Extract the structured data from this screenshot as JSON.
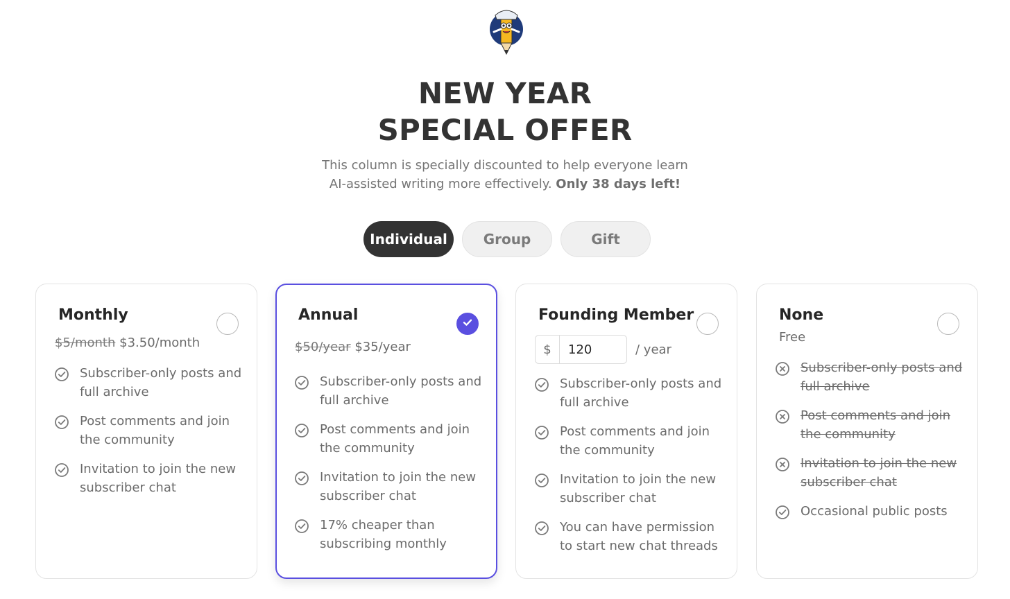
{
  "header": {
    "title": "NEW YEAR SPECIAL OFFER",
    "subtitle_text": "This column is specially discounted to help everyone learn AI-assisted writing more effectively.",
    "subtitle_bold": "Only 38 days left!"
  },
  "tabs": [
    {
      "label": "Individual",
      "active": true
    },
    {
      "label": "Group",
      "active": false
    },
    {
      "label": "Gift",
      "active": false
    }
  ],
  "accent_color": "#5a4fe0",
  "plans": {
    "monthly": {
      "name": "Monthly",
      "old_price": "$5/month",
      "new_price": "$3.50/month",
      "selected": false,
      "features": [
        "Subscriber-only posts and full archive",
        "Post comments and join the community",
        "Invitation to join the new subscriber chat"
      ]
    },
    "annual": {
      "name": "Annual",
      "old_price": "$50/year",
      "new_price": "$35/year",
      "selected": true,
      "features": [
        "Subscriber-only posts and full archive",
        "Post comments and join the community",
        "Invitation to join the new subscriber chat",
        "17% cheaper than subscribing monthly"
      ]
    },
    "founding": {
      "name": "Founding Member",
      "currency": "$",
      "amount": "120",
      "period": "/ year",
      "selected": false,
      "features": [
        "Subscriber-only posts and full archive",
        "Post comments and join the community",
        "Invitation to join the new subscriber chat",
        "You can have permission to start new chat threads"
      ]
    },
    "none": {
      "name": "None",
      "price": "Free",
      "selected": false,
      "features": [
        {
          "text": "Subscriber-only posts and full archive",
          "included": false
        },
        {
          "text": "Post comments and join the community",
          "included": false
        },
        {
          "text": "Invitation to join the new subscriber chat",
          "included": false
        },
        {
          "text": "Occasional public posts",
          "included": true
        }
      ]
    }
  }
}
